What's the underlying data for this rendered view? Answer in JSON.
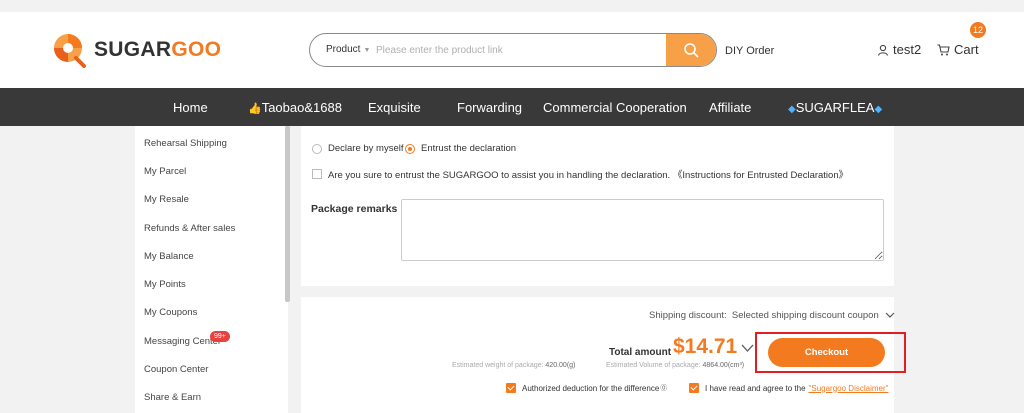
{
  "header": {
    "brand": {
      "part1": "SUGAR",
      "part2": "GOO"
    },
    "search": {
      "type": "Product",
      "placeholder": "Please enter the product link"
    },
    "diy_order": "DIY Order",
    "user_name": "test2",
    "cart_label": "Cart",
    "cart_count": "12"
  },
  "nav": {
    "items": [
      "Home",
      "Taobao&1688",
      "Exquisite",
      "Forwarding",
      "Commercial Cooperation",
      "Affiliate",
      "SUGARFLEA"
    ]
  },
  "sidebar": {
    "items": [
      "Rehearsal Shipping",
      "My Parcel",
      "My Resale",
      "Refunds & After sales",
      "My Balance",
      "My Points",
      "My Coupons",
      "Messaging Center",
      "Coupon Center",
      "Share & Earn"
    ],
    "messaging_badge": "99+"
  },
  "declaration": {
    "option_self": "Declare by myself",
    "option_entrust": "Entrust the declaration",
    "confirm_text": "Are you sure to entrust the SUGARGOO to assist you in handling the declaration. 《Instructions for Entrusted Declaration》"
  },
  "remarks": {
    "label": "Package remarks",
    "value": ""
  },
  "checkout": {
    "shipping_discount_label": "Shipping discount:",
    "shipping_discount_value": "Selected shipping discount coupon",
    "total_label": "Total amount",
    "total_amount": "$14.71",
    "est_weight_label": "Estimated weight of package:",
    "est_weight_value": "420.00(g)",
    "est_volume_label": "Estimated Volume of package:",
    "est_volume_value": "4864.00(cm³)",
    "button_label": "Checkout",
    "authorized_text": "Authorized deduction for the difference",
    "agree_text": "I have read and agree to the",
    "disclaimer_link": "\"Sugargoo Disclaimer\""
  },
  "colors": {
    "accent": "#f47a1f",
    "nav_bg": "#393939",
    "highlight_frame": "#e02020"
  }
}
